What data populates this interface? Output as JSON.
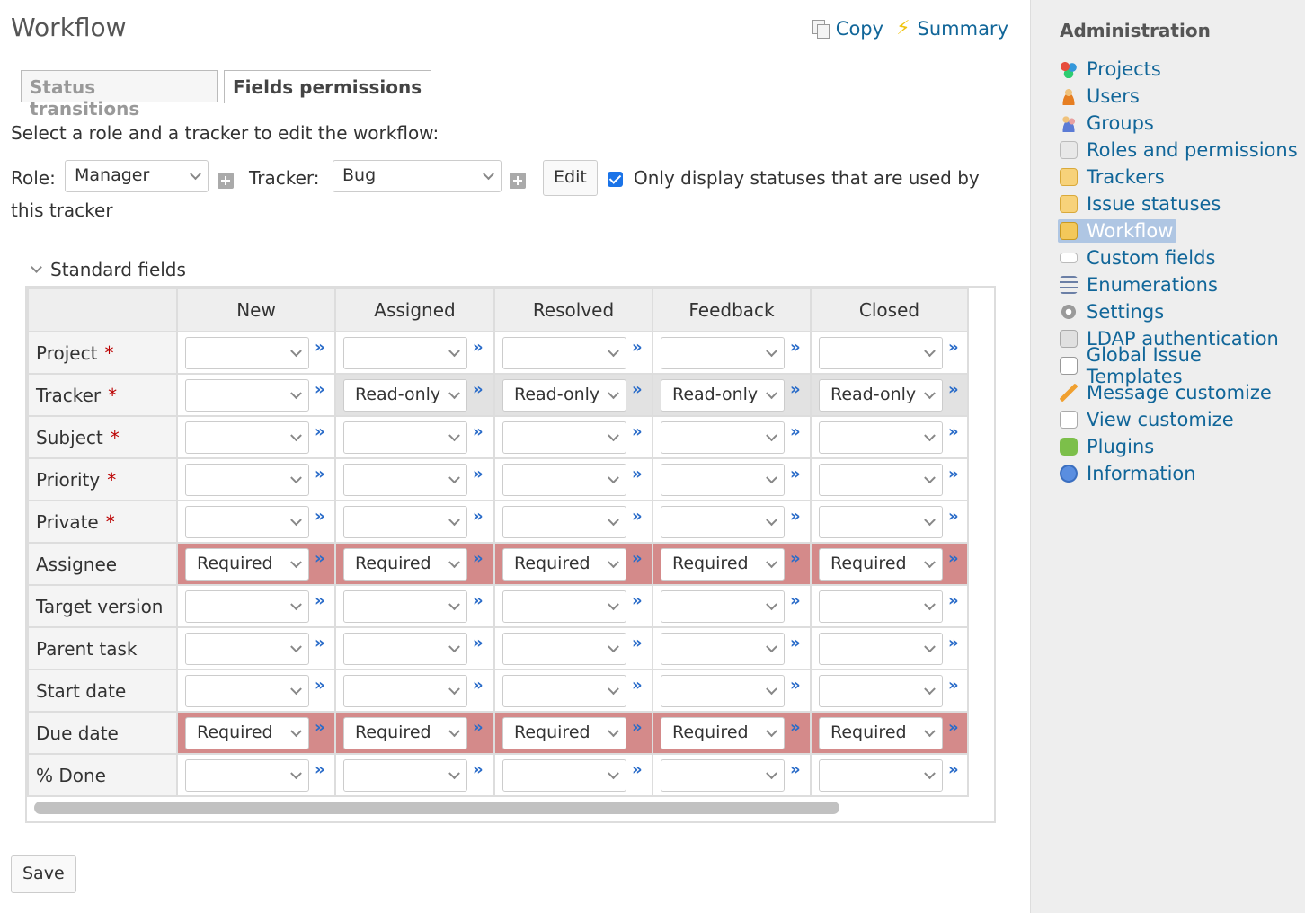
{
  "page_title": "Workflow",
  "contextual": {
    "copy": "Copy",
    "summary": "Summary"
  },
  "tabs": [
    {
      "label": "Status transitions",
      "selected": false
    },
    {
      "label": "Fields permissions",
      "selected": true
    }
  ],
  "instruction": "Select a role and a tracker to edit the workflow:",
  "filters": {
    "role_label": "Role:",
    "role_value": "Manager",
    "tracker_label": "Tracker:",
    "tracker_value": "Bug",
    "edit_button": "Edit",
    "only_used_checked": true,
    "only_used_label_1": "Only display statuses that are used by",
    "only_used_label_2": "this tracker"
  },
  "section_title": "Standard fields",
  "columns": [
    "New",
    "Assigned",
    "Resolved",
    "Feedback",
    "Closed"
  ],
  "rows": [
    {
      "name": "Project",
      "required": true,
      "values": [
        "",
        "",
        "",
        "",
        ""
      ]
    },
    {
      "name": "Tracker",
      "required": true,
      "values": [
        "",
        "Read-only",
        "Read-only",
        "Read-only",
        "Read-only"
      ]
    },
    {
      "name": "Subject",
      "required": true,
      "values": [
        "",
        "",
        "",
        "",
        ""
      ]
    },
    {
      "name": "Priority",
      "required": true,
      "values": [
        "",
        "",
        "",
        "",
        ""
      ]
    },
    {
      "name": "Private",
      "required": true,
      "values": [
        "",
        "",
        "",
        "",
        ""
      ]
    },
    {
      "name": "Assignee",
      "required": false,
      "values": [
        "Required",
        "Required",
        "Required",
        "Required",
        "Required"
      ]
    },
    {
      "name": "Target version",
      "required": false,
      "values": [
        "",
        "",
        "",
        "",
        ""
      ]
    },
    {
      "name": "Parent task",
      "required": false,
      "values": [
        "",
        "",
        "",
        "",
        ""
      ]
    },
    {
      "name": "Start date",
      "required": false,
      "values": [
        "",
        "",
        "",
        "",
        ""
      ]
    },
    {
      "name": "Due date",
      "required": false,
      "values": [
        "Required",
        "Required",
        "Required",
        "Required",
        "Required"
      ]
    },
    {
      "name": "% Done",
      "required": false,
      "values": [
        "",
        "",
        "",
        "",
        ""
      ]
    }
  ],
  "required_marker": "*",
  "row_action_glyph": "»",
  "save_button": "Save",
  "sidebar": {
    "title": "Administration",
    "items": [
      {
        "label": "Projects",
        "icon": "projects-icon",
        "selected": false
      },
      {
        "label": "Users",
        "icon": "user-icon",
        "selected": false
      },
      {
        "label": "Groups",
        "icon": "group-icon",
        "selected": false
      },
      {
        "label": "Roles and permissions",
        "icon": "roles-icon",
        "selected": false
      },
      {
        "label": "Trackers",
        "icon": "tracker-icon",
        "selected": false
      },
      {
        "label": "Issue statuses",
        "icon": "issue-status-icon",
        "selected": false
      },
      {
        "label": "Workflow",
        "icon": "workflow-icon",
        "selected": true
      },
      {
        "label": "Custom fields",
        "icon": "custom-fields-icon",
        "selected": false
      },
      {
        "label": "Enumerations",
        "icon": "list-icon",
        "selected": false
      },
      {
        "label": "Settings",
        "icon": "gear-icon",
        "selected": false
      },
      {
        "label": "LDAP authentication",
        "icon": "server-auth-icon",
        "selected": false
      },
      {
        "label": "Global Issue Templates",
        "icon": "template-icon",
        "selected": false
      },
      {
        "label": "Message customize",
        "icon": "pencil-icon",
        "selected": false
      },
      {
        "label": "View customize",
        "icon": "view-customize-icon",
        "selected": false
      },
      {
        "label": "Plugins",
        "icon": "plugin-icon",
        "selected": false
      },
      {
        "label": "Information",
        "icon": "help-icon",
        "selected": false
      }
    ]
  },
  "colors": {
    "link": "#116699",
    "required_cell": "#d48a8a",
    "readonly_cell": "#e2e2e2",
    "required_marker": "#bb0000",
    "selected_menu": "#afc6e3"
  }
}
